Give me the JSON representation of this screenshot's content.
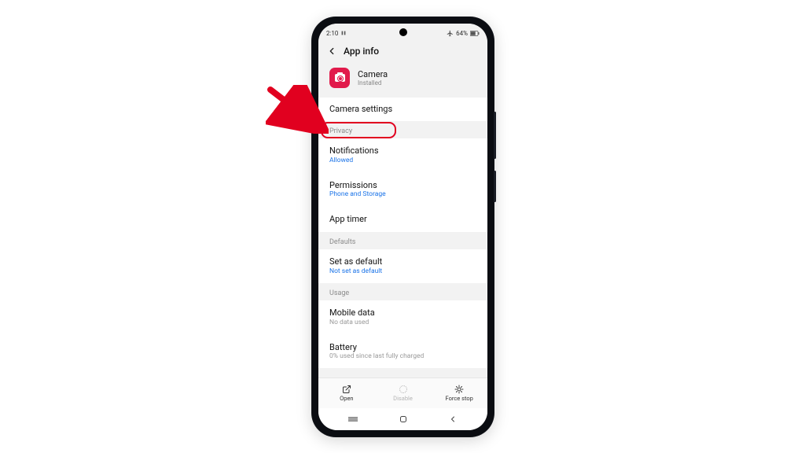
{
  "status": {
    "time": "2:10",
    "battery_text": "64%"
  },
  "header": {
    "title": "App info"
  },
  "app": {
    "name": "Camera",
    "status": "Installed"
  },
  "rows": {
    "camera_settings": "Camera settings",
    "notifications": {
      "title": "Notifications",
      "sub": "Allowed"
    },
    "permissions": {
      "title": "Permissions",
      "sub": "Phone and Storage"
    },
    "app_timer": {
      "title": "App timer"
    },
    "set_default": {
      "title": "Set as default",
      "sub": "Not set as default"
    },
    "mobile_data": {
      "title": "Mobile data",
      "sub": "No data used"
    },
    "battery": {
      "title": "Battery",
      "sub": "0% used since last fully charged"
    }
  },
  "sections": {
    "privacy": "Privacy",
    "defaults": "Defaults",
    "usage": "Usage"
  },
  "actions": {
    "open": "Open",
    "disable": "Disable",
    "force_stop": "Force stop"
  },
  "annotation": {
    "highlight_target": "Camera settings"
  }
}
